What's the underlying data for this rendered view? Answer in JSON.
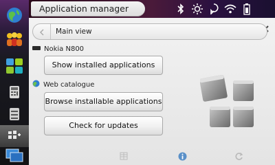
{
  "window": {
    "title": "Application manager"
  },
  "status_icons": [
    "bluetooth-icon",
    "brightness-icon",
    "presence-icon",
    "wifi-icon",
    "battery-icon"
  ],
  "window_controls": [
    "minimize-icon",
    "close-icon"
  ],
  "sidebar": {
    "items": [
      {
        "name": "web-browser-icon"
      },
      {
        "name": "contacts-icon"
      },
      {
        "name": "app-menu-icon"
      },
      {
        "name": "calculator-icon"
      },
      {
        "name": "control-panel-icon"
      },
      {
        "name": "application-manager-icon",
        "active": true
      },
      {
        "name": "task-switcher-icon"
      }
    ]
  },
  "nav": {
    "label": "Main view"
  },
  "sections": {
    "device": {
      "label": "Nokia N800",
      "icon": "device-icon"
    },
    "catalogue": {
      "label": "Web catalogue",
      "icon": "globe-icon"
    }
  },
  "buttons": {
    "show_installed": "Show installed applications",
    "browse_installable": "Browse installable applications",
    "check_updates": "Check for updates"
  },
  "bottom_toolbar": [
    "catalogue-list-icon",
    "details-icon",
    "refresh-icon"
  ],
  "colors": {
    "accent": "#5a2a6a",
    "content_bg": "#e8e8e8"
  }
}
